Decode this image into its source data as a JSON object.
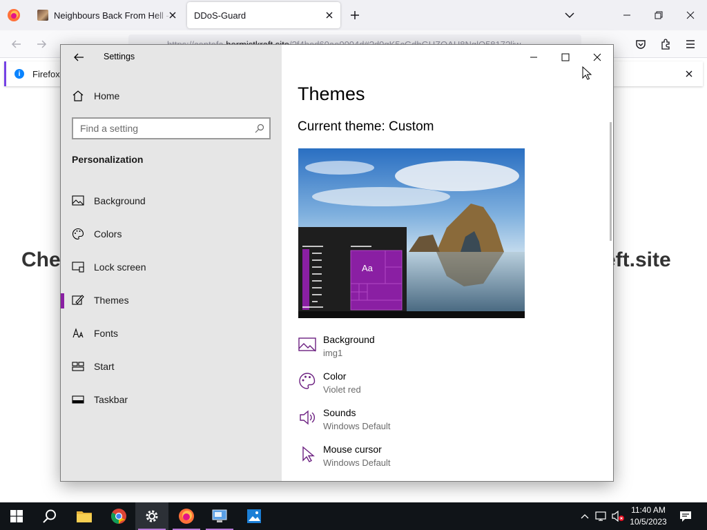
{
  "browser": {
    "tabs": [
      {
        "label": "Neighbours Back From Hell - v"
      },
      {
        "label": "DDoS-Guard"
      }
    ],
    "url": {
      "prefix": "https://",
      "faded1": "centefa.",
      "domain": "hermistkraft.site",
      "rest": "/?f4bed60ae0004d#?d0gK5cGdhGUZOAH8NglQ5817?liw"
    },
    "notification": "Firefox a",
    "page_heading_left": "Che",
    "page_heading_right": "eft.site"
  },
  "settings": {
    "title": "Settings",
    "home": "Home",
    "search_placeholder": "Find a setting",
    "section": "Personalization",
    "nav": [
      {
        "label": "Background",
        "icon": "image-icon"
      },
      {
        "label": "Colors",
        "icon": "palette-icon"
      },
      {
        "label": "Lock screen",
        "icon": "lock-screen-icon"
      },
      {
        "label": "Themes",
        "icon": "brush-icon",
        "active": true
      },
      {
        "label": "Fonts",
        "icon": "fonts-icon"
      },
      {
        "label": "Start",
        "icon": "start-icon"
      },
      {
        "label": "Taskbar",
        "icon": "taskbar-icon"
      }
    ],
    "main": {
      "title": "Themes",
      "current_theme": "Current theme: Custom",
      "preview_tile_text": "Aa",
      "props": [
        {
          "name": "Background",
          "value": "img1",
          "icon": "image-icon"
        },
        {
          "name": "Color",
          "value": "Violet red",
          "icon": "palette-icon"
        },
        {
          "name": "Sounds",
          "value": "Windows Default",
          "icon": "speaker-icon"
        },
        {
          "name": "Mouse cursor",
          "value": "Windows Default",
          "icon": "cursor-icon"
        }
      ]
    }
  },
  "colors": {
    "accent": "#8a1fa3",
    "taskbar": "#101418",
    "sidebar": "#e6e6e6"
  },
  "taskbar": {
    "time": "11:40 AM",
    "date": "10/5/2023"
  }
}
